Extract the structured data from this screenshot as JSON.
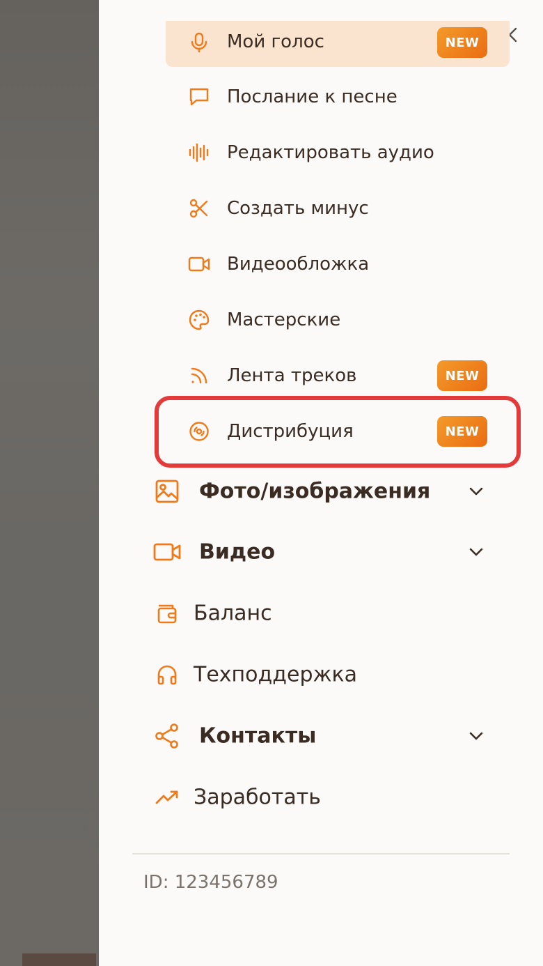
{
  "colors": {
    "accent": "#f07a1a",
    "badge_start": "#f39a2a",
    "badge_end": "#ea6d12",
    "active_bg": "#fbe4cf",
    "highlight_border": "#e43a3a",
    "text": "#3a2c22",
    "muted_text": "#7a726b"
  },
  "menu": {
    "sub_items": [
      {
        "label": "Мой голос",
        "icon": "microphone-icon",
        "badge": "NEW",
        "active": true
      },
      {
        "label": "Послание к песне",
        "icon": "message-icon"
      },
      {
        "label": "Редактировать аудио",
        "icon": "waveform-icon"
      },
      {
        "label": "Создать минус",
        "icon": "scissors-icon"
      },
      {
        "label": "Видеообложка",
        "icon": "video-camera-icon"
      },
      {
        "label": "Мастерские",
        "icon": "palette-icon"
      },
      {
        "label": "Лента треков",
        "icon": "rss-icon",
        "badge": "NEW"
      },
      {
        "label": "Дистрибуция",
        "icon": "disc-icon",
        "badge": "NEW",
        "highlighted": true
      }
    ],
    "main_items": [
      {
        "label": "Фото/изображения",
        "icon": "image-icon",
        "expandable": true
      },
      {
        "label": "Видео",
        "icon": "video-icon",
        "expandable": true
      },
      {
        "label": "Баланс",
        "icon": "wallet-icon"
      },
      {
        "label": "Техподдержка",
        "icon": "headphones-icon"
      },
      {
        "label": "Контакты",
        "icon": "share-icon",
        "expandable": true
      },
      {
        "label": "Заработать",
        "icon": "trending-up-icon"
      }
    ]
  },
  "footer": {
    "user_id": "ID: 123456789"
  },
  "close_icon": "close-icon"
}
